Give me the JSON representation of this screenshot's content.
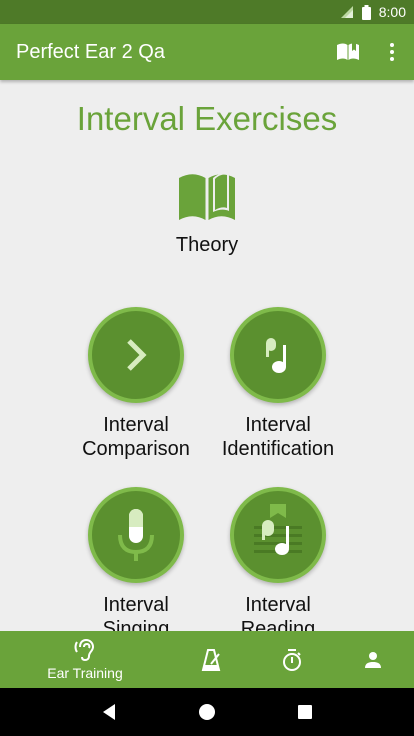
{
  "status_bar": {
    "time": "8:00",
    "icons": [
      "wifi-icon",
      "signal-icon",
      "battery-icon"
    ]
  },
  "app_bar": {
    "title": "Perfect Ear 2 Qa",
    "actions": [
      "book-icon",
      "more-vert-icon"
    ]
  },
  "content": {
    "page_title": "Interval Exercises",
    "theory": {
      "label": "Theory",
      "icon": "open-book-icon"
    },
    "exercises": [
      {
        "line1": "Interval",
        "line2": "Comparison",
        "icon": "chevron-right-icon"
      },
      {
        "line1": "Interval",
        "line2": "Identification",
        "icon": "music-note-icon"
      },
      {
        "line1": "Interval",
        "line2": "Singing",
        "icon": "microphone-icon"
      },
      {
        "line1": "Interval",
        "line2": "Reading",
        "icon": "sheet-music-icon"
      }
    ]
  },
  "bottom_nav": {
    "items": [
      {
        "label": "Ear Training",
        "icon": "ear-icon",
        "active": true
      },
      {
        "label": "",
        "icon": "metronome-icon"
      },
      {
        "label": "",
        "icon": "stopwatch-icon"
      },
      {
        "label": "",
        "icon": "person-icon"
      }
    ]
  },
  "system_nav": [
    "back-icon",
    "home-icon",
    "recents-icon"
  ],
  "colors": {
    "primary": "#6aa33a",
    "primary_dark": "#4e7a28",
    "circle_fill": "#5b902f",
    "circle_ring": "#7fba4a",
    "icon_light": "#d7ecc0",
    "background": "#eeeeee"
  }
}
